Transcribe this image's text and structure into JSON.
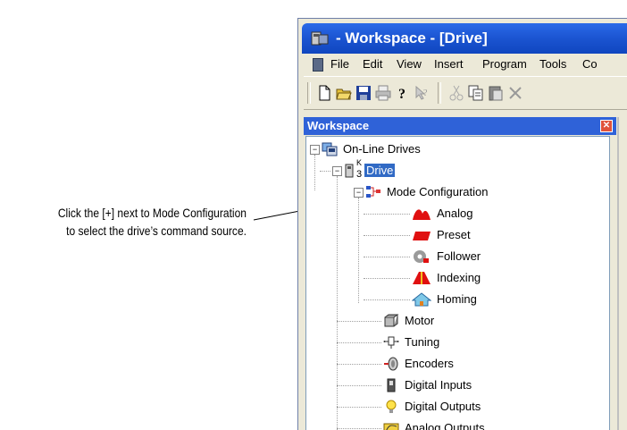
{
  "callout": {
    "line1": "Click the [+] next to Mode Configuration",
    "line2": "to select the drive’s command source."
  },
  "window": {
    "title": " - Workspace - [Drive]",
    "menu": [
      "File",
      "Edit",
      "View",
      "Insert",
      "Program",
      "Tools",
      "Co"
    ],
    "toolbar_icons": [
      "new-icon",
      "open-icon",
      "save-icon",
      "print-icon",
      "help-icon",
      "context-help-icon",
      "cut-icon",
      "copy-icon",
      "paste-icon",
      "delete-icon"
    ]
  },
  "workspace": {
    "header": "Workspace",
    "close_glyph": "✕",
    "tree": {
      "root": "On-Line Drives",
      "drive": "Drive",
      "drive_superscript": "K",
      "drive_subscript": "3",
      "mode_configuration": "Mode Configuration",
      "modes": [
        "Analog",
        "Preset",
        "Follower",
        "Indexing",
        "Homing"
      ],
      "items": [
        "Motor",
        "Tuning",
        "Encoders",
        "Digital Inputs",
        "Digital Outputs",
        "Analog Outputs"
      ]
    },
    "expander_glyph": "−"
  },
  "colors": {
    "title_bar": "#1b54d1",
    "pane_header": "#2f62d8",
    "selection": "#316ac5",
    "window_bg": "#ece9d8"
  }
}
